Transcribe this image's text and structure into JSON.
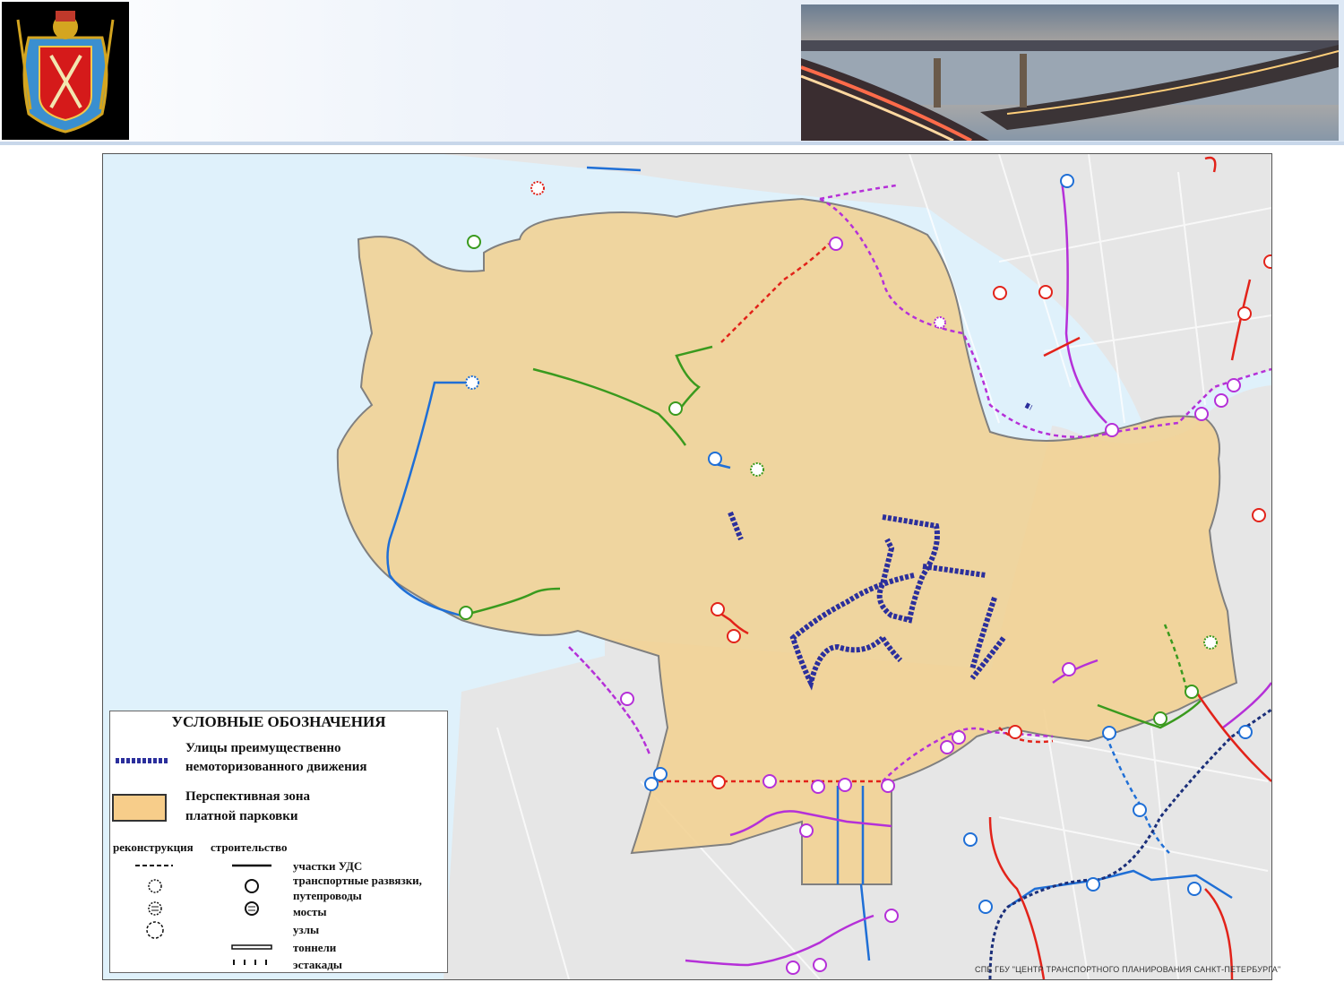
{
  "legend": {
    "title": "УСЛОВНЫЕ ОБОЗНАЧЕНИЯ",
    "pedestrian_line1": "Улицы преимущественно",
    "pedestrian_line2": "немоторизованного движения",
    "parking_line1": "Перспективная зона",
    "parking_line2": "платной парковки",
    "col_reconstruction": "реконструкция",
    "col_construction": "строительство",
    "roads": "участки УДС",
    "interchanges_line1": "транспортные развязки,",
    "interchanges_line2": "путепроводы",
    "bridges": "мосты",
    "nodes": "узлы",
    "tunnels": "тоннели",
    "overpasses": "эстакады"
  },
  "credit": "СПБ ГБУ \"ЦЕНТР ТРАНСПОРТНОГО ПЛАНИРОВАНИЯ САНКТ-ПЕТЕРБУРГА\"",
  "colors": {
    "water": "#dff1fb",
    "land": "#e6e6e6",
    "parking_zone": "#f2d08e",
    "pedestrian": "#2b2f9c",
    "road_red": "#e2231a",
    "road_purple": "#b530d8",
    "road_blue": "#1f6fd6",
    "road_green": "#3a9a1e"
  },
  "icons": [
    "coat-of-arms-icon",
    "interchange-icon",
    "bridge-icon",
    "node-icon"
  ]
}
